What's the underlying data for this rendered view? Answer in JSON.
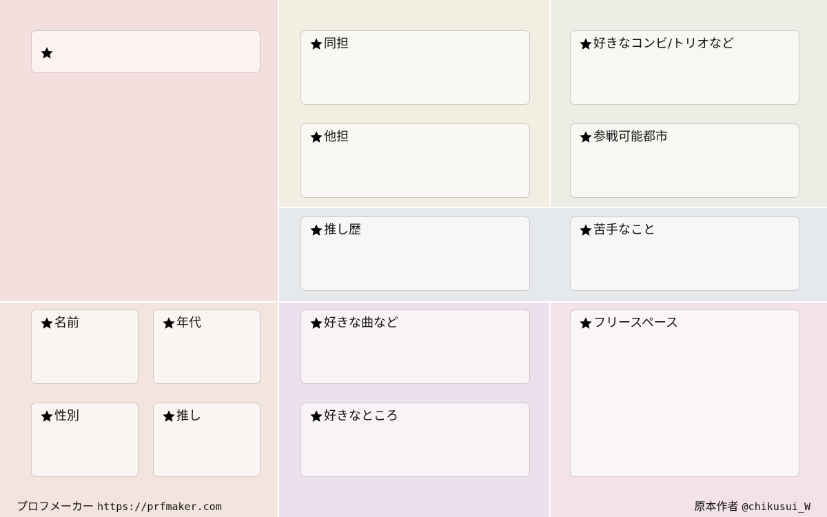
{
  "colors": {
    "pink_panel": "#f3dfdd",
    "cream_panel": "#f3eee2",
    "green_panel": "#ebeee4",
    "blue_panel": "#e6e9ec",
    "peach_panel": "#f3e5dd",
    "lavender_panel": "#ece0ec",
    "rose_panel": "#f3e2ea",
    "box_fill": "#faf7f3"
  },
  "icon": "star-icon",
  "fields": {
    "top_left": "",
    "doutan": "同担",
    "tatan": "他担",
    "combi": "好きなコンビ/トリオなど",
    "city": "参戦可能都市",
    "history": "推し歴",
    "dislike": "苦手なこと",
    "name": "名前",
    "age": "年代",
    "gender": "性別",
    "oshi": "推し",
    "song": "好きな曲など",
    "likes": "好きなところ",
    "free": "フリースペース"
  },
  "footer": {
    "left_prefix": "プロフメーカー",
    "left_url": "https://prfmaker.com",
    "right_prefix": "原本作者",
    "right_handle": "@chikusui_W"
  }
}
